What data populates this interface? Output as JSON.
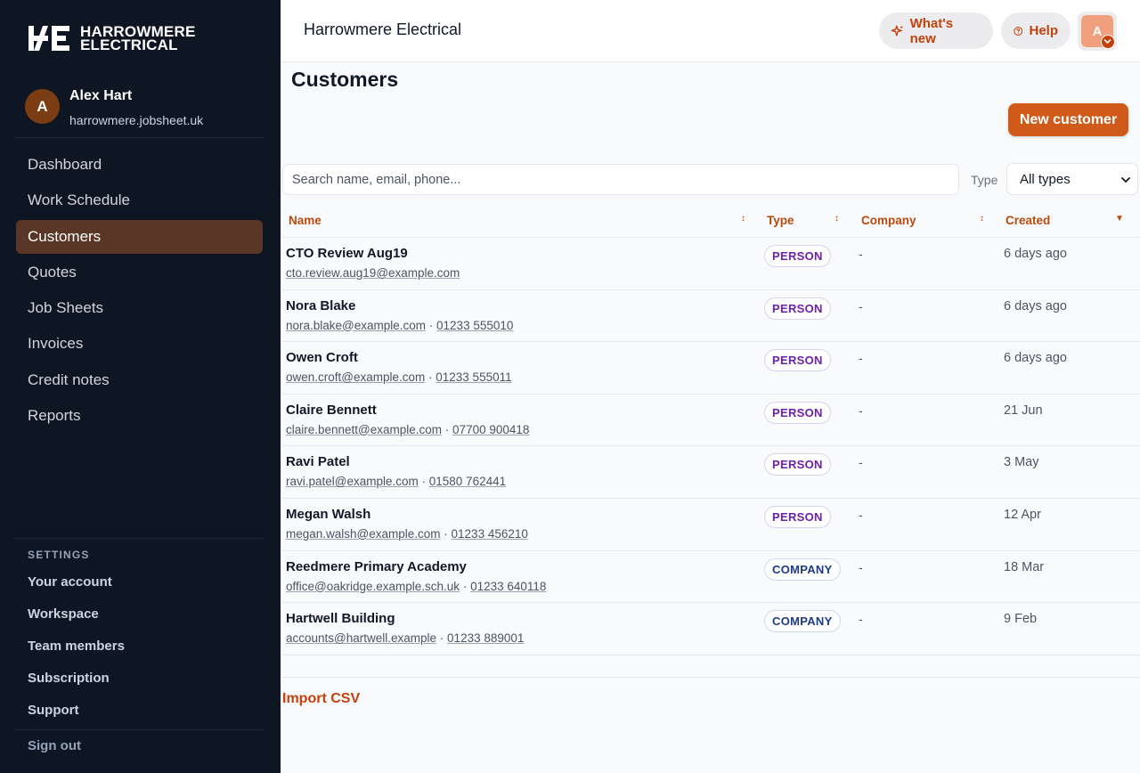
{
  "brand": {
    "logo_line1": "HARROWMERE",
    "logo_line2": "ELECTRICAL",
    "accent": "#cf5a1a",
    "sidebar_bg": "#0f1623"
  },
  "user": {
    "initial": "A",
    "name": "Alex Hart",
    "domain": "harrowmere.jobsheet.uk"
  },
  "nav": [
    {
      "label": "Dashboard",
      "active": false
    },
    {
      "label": "Work Schedule",
      "active": false
    },
    {
      "label": "Customers",
      "active": true
    },
    {
      "label": "Quotes",
      "active": false
    },
    {
      "label": "Job Sheets",
      "active": false
    },
    {
      "label": "Invoices",
      "active": false
    },
    {
      "label": "Credit notes",
      "active": false
    },
    {
      "label": "Reports",
      "active": false
    }
  ],
  "settings": {
    "title": "SETTINGS",
    "items": [
      "Your account",
      "Workspace",
      "Team members",
      "Subscription",
      "Support"
    ]
  },
  "sign_out": "Sign out",
  "header": {
    "org_name": "Harrowmere Electrical",
    "whats_new": "What's new",
    "help": "Help",
    "avatar_initial": "A"
  },
  "page": {
    "title": "Customers",
    "new_button": "New customer",
    "search_placeholder": "Search name, email, phone...",
    "type_label": "Type",
    "type_value": "All types",
    "import_csv": "Import CSV"
  },
  "table": {
    "columns": {
      "name": "Name",
      "type": "Type",
      "company": "Company",
      "created": "Created"
    },
    "rows": [
      {
        "name": "CTO Review Aug19",
        "email": "cto.review.aug19@example.com",
        "phone": "",
        "type": "PERSON",
        "company": "-",
        "created": "6 days ago"
      },
      {
        "name": "Nora Blake",
        "email": "nora.blake@example.com",
        "phone": "01233 555010",
        "type": "PERSON",
        "company": "-",
        "created": "6 days ago"
      },
      {
        "name": "Owen Croft",
        "email": "owen.croft@example.com",
        "phone": "01233 555011",
        "type": "PERSON",
        "company": "-",
        "created": "6 days ago"
      },
      {
        "name": "Claire Bennett",
        "email": "claire.bennett@example.com",
        "phone": "07700 900418",
        "type": "PERSON",
        "company": "-",
        "created": "21 Jun"
      },
      {
        "name": "Ravi Patel",
        "email": "ravi.patel@example.com",
        "phone": "01580 762441",
        "type": "PERSON",
        "company": "-",
        "created": "3 May"
      },
      {
        "name": "Megan Walsh",
        "email": "megan.walsh@example.com",
        "phone": "01233 456210",
        "type": "PERSON",
        "company": "-",
        "created": "12 Apr"
      },
      {
        "name": "Reedmere Primary Academy",
        "email": "office@oakridge.example.sch.uk",
        "phone": "01233 640118",
        "type": "COMPANY",
        "company": "-",
        "created": "18 Mar"
      },
      {
        "name": "Hartwell Building",
        "email": "accounts@hartwell.example",
        "phone": "01233 889001",
        "type": "COMPANY",
        "company": "-",
        "created": "9 Feb"
      }
    ]
  }
}
